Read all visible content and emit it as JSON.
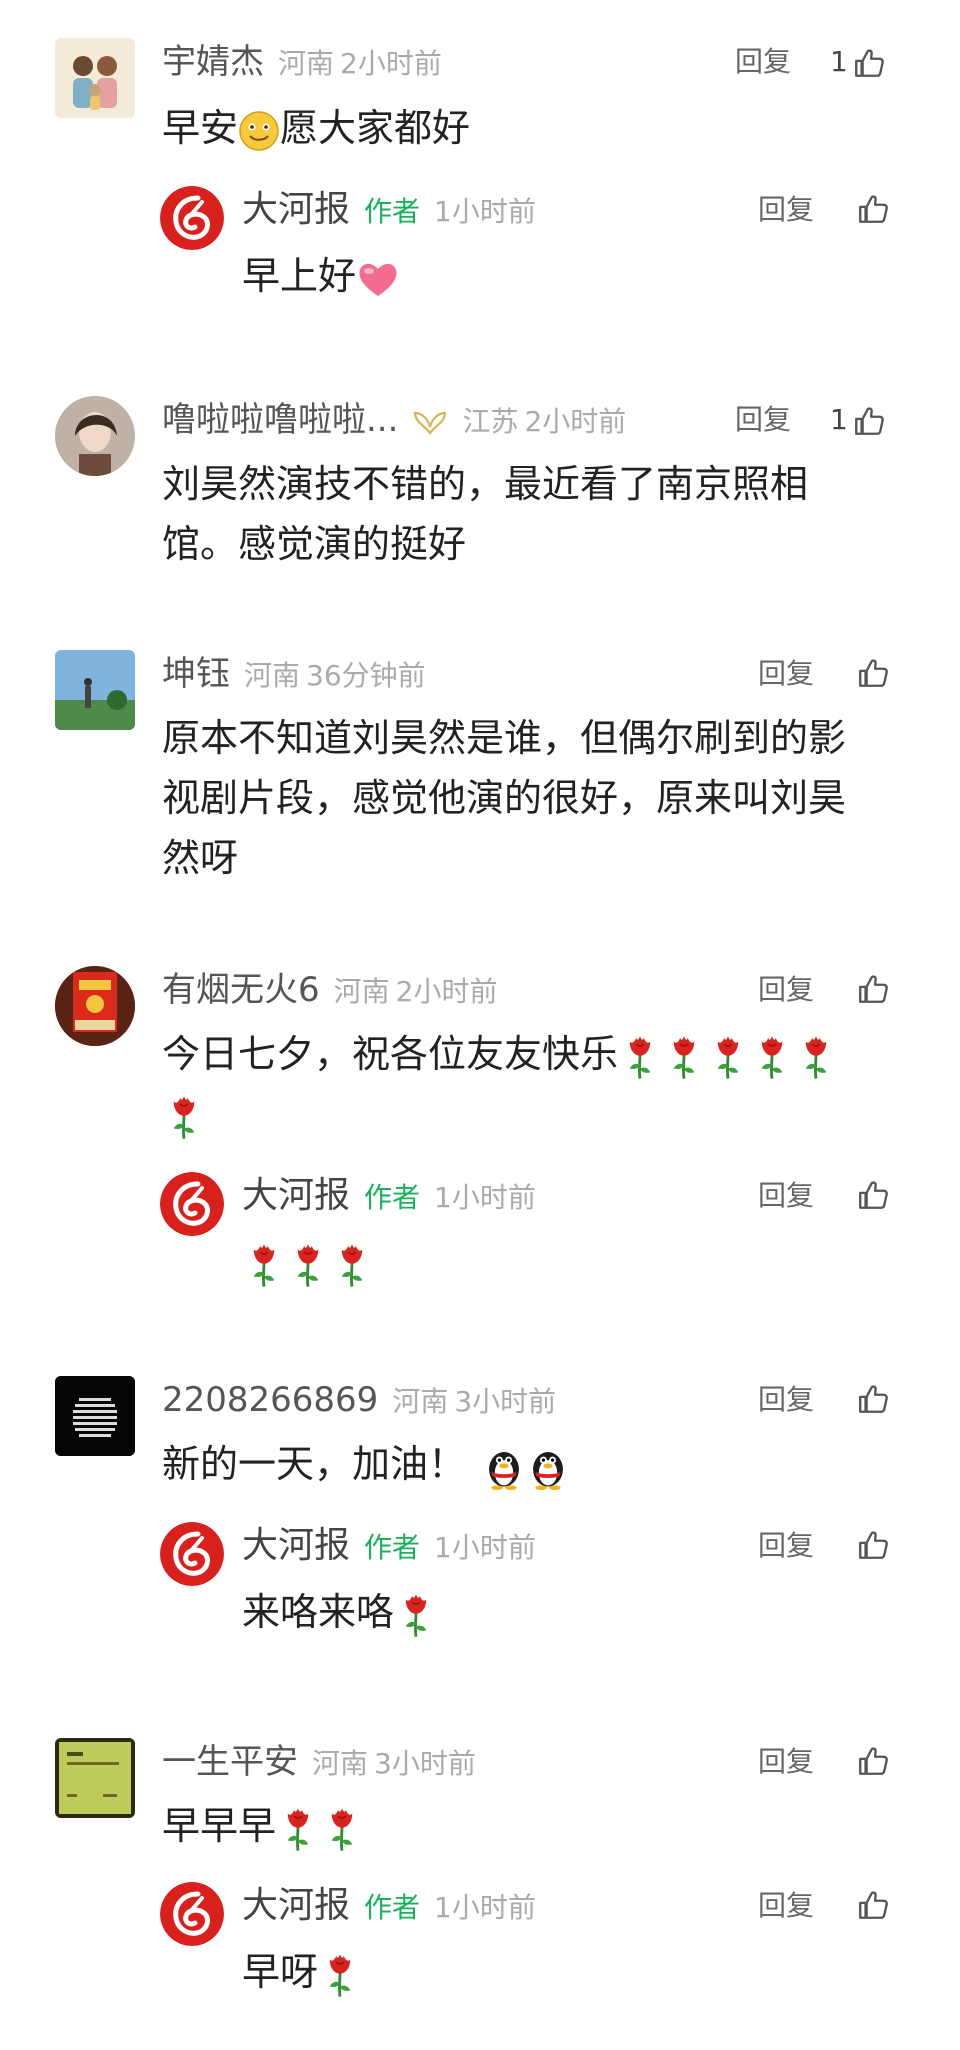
{
  "comments": [
    {
      "name": "宇婧杰",
      "location": "河南",
      "time": "2小时前",
      "reply_label": "回复",
      "likes": "1",
      "text": "早安",
      "text2": "愿大家都好",
      "author_reply": {
        "name": "大河报",
        "badge": "作者",
        "time": "1小时前",
        "reply_label": "回复",
        "text": "早上好"
      }
    },
    {
      "name": "噜啦啦噜啦啦...",
      "location": "江苏",
      "time": "2小时前",
      "reply_label": "回复",
      "likes": "1",
      "text": "刘昊然演技不错的，最近看了南京照相馆。感觉演的挺好"
    },
    {
      "name": "坤钰",
      "location": "河南",
      "time": "36分钟前",
      "reply_label": "回复",
      "text": "原本不知道刘昊然是谁，但偶尔刷到的影视剧片段，感觉他演的很好，原来叫刘昊然呀"
    },
    {
      "name": "有烟无火6",
      "location": "河南",
      "time": "2小时前",
      "reply_label": "回复",
      "text": "今日七夕，祝各位友友快乐",
      "author_reply": {
        "name": "大河报",
        "badge": "作者",
        "time": "1小时前",
        "reply_label": "回复",
        "text": ""
      }
    },
    {
      "name": "2208266869",
      "location": "河南",
      "time": "3小时前",
      "reply_label": "回复",
      "text": "新的一天，加油！",
      "author_reply": {
        "name": "大河报",
        "badge": "作者",
        "time": "1小时前",
        "reply_label": "回复",
        "text": "来咯来咯"
      }
    },
    {
      "name": "一生平安",
      "location": "河南",
      "time": "3小时前",
      "reply_label": "回复",
      "text": "早早早",
      "author_reply": {
        "name": "大河报",
        "badge": "作者",
        "time": "1小时前",
        "reply_label": "回复",
        "text": "早呀"
      }
    }
  ],
  "colors": {
    "author_badge": "#19b15a",
    "meta": "#aaaaaa",
    "brand_red": "#d9201c"
  },
  "icons": [
    "thumbs-up-icon",
    "smile-emoji-icon",
    "heart-emoji-icon",
    "rose-emoji-icon",
    "penguin-emoji-icon",
    "gold-wings-badge-icon",
    "dahebao-logo-icon"
  ]
}
